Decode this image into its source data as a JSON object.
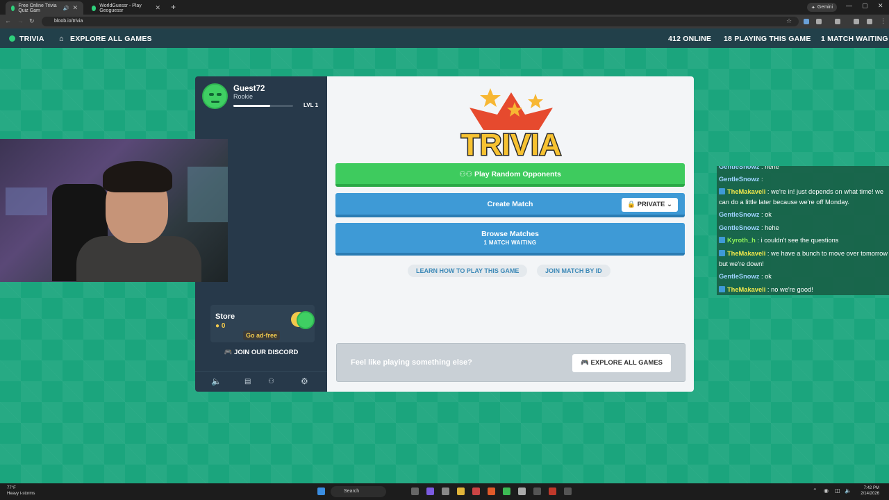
{
  "browser": {
    "tabs": [
      {
        "title": "Free Online Trivia Quiz Gam",
        "favicon_color": "#2fd07b"
      },
      {
        "title": "WorldGuessr - Play Geoguessr",
        "favicon_color": "#2fd07b"
      }
    ],
    "gemini_label": "Gemini",
    "url": "bloob.io/trivia"
  },
  "site_header": {
    "trivia_label": "TRIVIA",
    "explore_label": "EXPLORE ALL GAMES",
    "online_count": "412 ONLINE",
    "playing_count": "18 PLAYING THIS GAME",
    "waiting_count": "1 MATCH WAITING"
  },
  "profile": {
    "name": "Guest72",
    "rank": "Rookie",
    "level": "LVL 1",
    "xp_fraction": 0.62
  },
  "store": {
    "title": "Store",
    "coins": "0",
    "ad_free_label": "Go ad-free"
  },
  "discord_label": "JOIN OUR DISCORD",
  "sidebar_footer": {
    "icons": [
      "volume-icon",
      "news-icon",
      "users-icon",
      "gear-icon"
    ]
  },
  "main": {
    "logo_text": "TRIVIA",
    "play_random_label": "Play Random Opponents",
    "create_match_label": "Create Match",
    "private_label": "PRIVATE",
    "browse_matches_label": "Browse Matches",
    "browse_matches_sub": "1 MATCH WAITING",
    "learn_label": "LEARN HOW TO PLAY THIS GAME",
    "join_by_id_label": "JOIN MATCH BY ID",
    "feel_like_text": "Feel like playing something else?",
    "explore_button_label": "EXPLORE ALL GAMES"
  },
  "chat": [
    {
      "user": "GentleSnowz",
      "text": ": hehe",
      "color": "#9fd3ff",
      "badge": false
    },
    {
      "user": "GentleSnowz",
      "text": ":",
      "color": "#9fd3ff",
      "badge": false
    },
    {
      "user": "TheMakaveli",
      "text": ": we're in! just depends on what time! we can do a little later because we're off Monday.",
      "color": "#f2e94c",
      "badge": true
    },
    {
      "user": "GentleSnowz",
      "text": ": ok",
      "color": "#9fd3ff",
      "badge": false
    },
    {
      "user": "GentleSnowz",
      "text": ": hehe",
      "color": "#9fd3ff",
      "badge": false
    },
    {
      "user": "Kyroth_h",
      "text": ": i couldn't see the questions",
      "color": "#8df05a",
      "badge": true
    },
    {
      "user": "TheMakaveli",
      "text": ": we have a bunch to move over tomorrow but we're down!",
      "color": "#f2e94c",
      "badge": true
    },
    {
      "user": "GentleSnowz",
      "text": ": ok",
      "color": "#9fd3ff",
      "badge": false
    },
    {
      "user": "TheMakaveli",
      "text": ": no we're good!",
      "color": "#f2e94c",
      "badge": true
    }
  ],
  "taskbar": {
    "weather_temp": "77°F",
    "weather_text": "Heavy t-storms",
    "search_label": "Search",
    "time": "7:42 PM",
    "date": "2/14/2026"
  }
}
